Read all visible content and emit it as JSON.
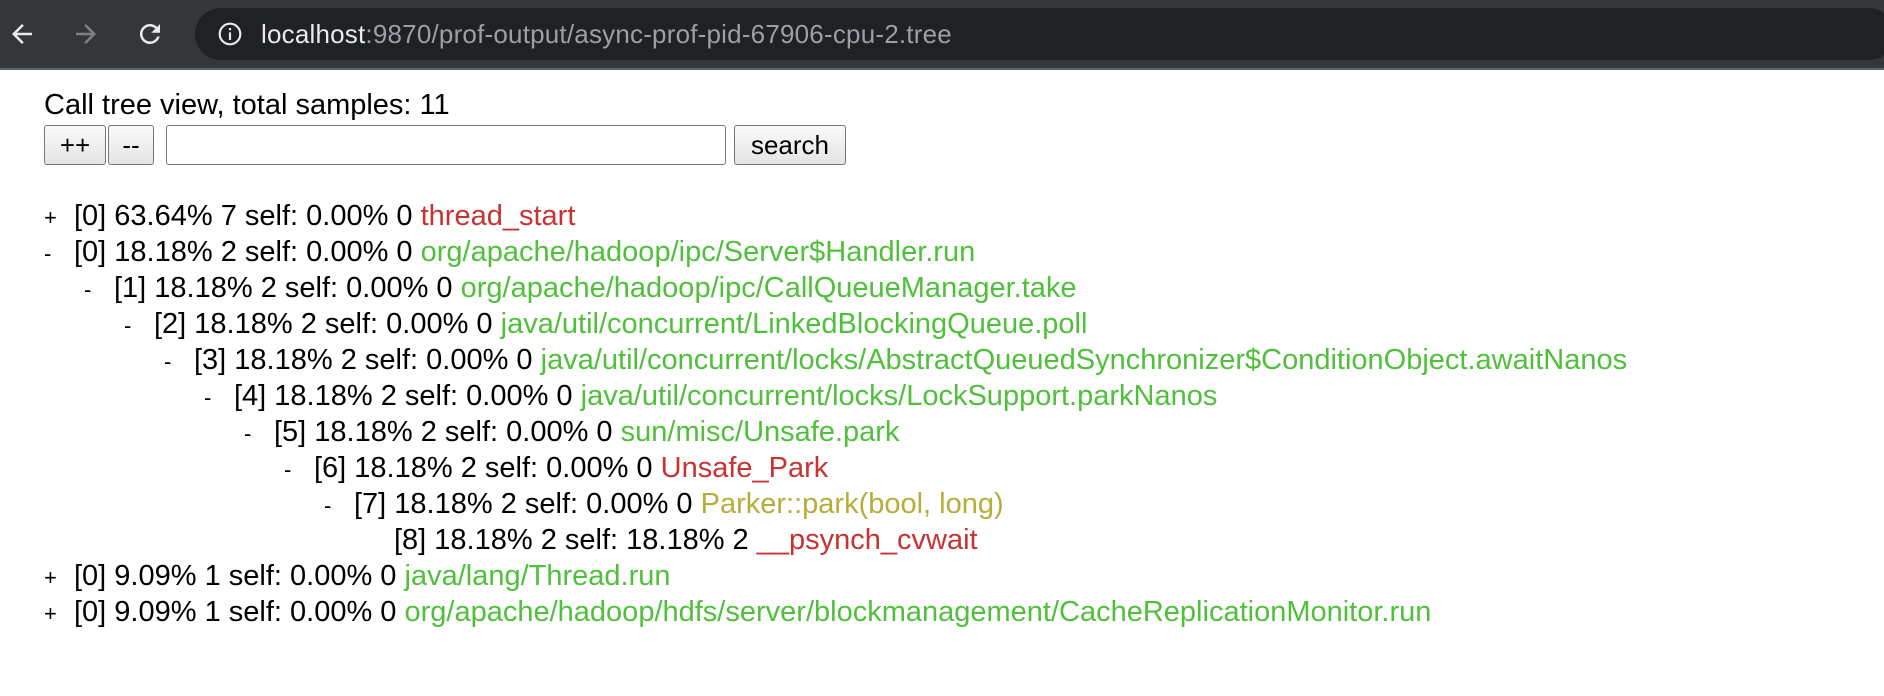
{
  "browser": {
    "url_host": "localhost",
    "url_rest": ":9870/prof-output/async-prof-pid-67906-cpu-2.tree",
    "icons": {
      "back": "arrow-left-icon",
      "forward": "arrow-right-icon",
      "reload": "reload-icon",
      "site_info": "info-icon"
    }
  },
  "page": {
    "title": "Call tree view, total samples: 11",
    "expand_label": "++",
    "collapse_label": "--",
    "search_value": "",
    "search_label": "search"
  },
  "colors": {
    "java_frame": "#50c03c",
    "native_frame": "#c93232",
    "cpp_frame": "#b6ad3a"
  },
  "tree": [
    {
      "toggle": "+",
      "level": 0,
      "info": "[0] 63.64% 7 self: 0.00% 0",
      "name": "thread_start",
      "kind": "red"
    },
    {
      "toggle": "-",
      "level": 0,
      "info": "[0] 18.18% 2 self: 0.00% 0",
      "name": "org/apache/hadoop/ipc/Server$Handler.run",
      "kind": "green"
    },
    {
      "toggle": "-",
      "level": 1,
      "info": "[1] 18.18% 2 self: 0.00% 0",
      "name": "org/apache/hadoop/ipc/CallQueueManager.take",
      "kind": "green"
    },
    {
      "toggle": "-",
      "level": 2,
      "info": "[2] 18.18% 2 self: 0.00% 0",
      "name": "java/util/concurrent/LinkedBlockingQueue.poll",
      "kind": "green"
    },
    {
      "toggle": "-",
      "level": 3,
      "info": "[3] 18.18% 2 self: 0.00% 0",
      "name": "java/util/concurrent/locks/AbstractQueuedSynchronizer$ConditionObject.awaitNanos",
      "kind": "green"
    },
    {
      "toggle": "-",
      "level": 4,
      "info": "[4] 18.18% 2 self: 0.00% 0",
      "name": "java/util/concurrent/locks/LockSupport.parkNanos",
      "kind": "green"
    },
    {
      "toggle": "-",
      "level": 5,
      "info": "[5] 18.18% 2 self: 0.00% 0",
      "name": "sun/misc/Unsafe.park",
      "kind": "green"
    },
    {
      "toggle": "-",
      "level": 6,
      "info": "[6] 18.18% 2 self: 0.00% 0",
      "name": "Unsafe_Park",
      "kind": "red"
    },
    {
      "toggle": "-",
      "level": 7,
      "info": "[7] 18.18% 2 self: 0.00% 0",
      "name": "Parker::park(bool, long)",
      "kind": "olive"
    },
    {
      "toggle": "",
      "level": 8,
      "info": "[8] 18.18% 2 self: 18.18% 2",
      "name": "__psynch_cvwait",
      "kind": "red"
    },
    {
      "toggle": "+",
      "level": 0,
      "info": "[0] 9.09% 1 self: 0.00% 0",
      "name": "java/lang/Thread.run",
      "kind": "green"
    },
    {
      "toggle": "+",
      "level": 0,
      "info": "[0] 9.09% 1 self: 0.00% 0",
      "name": "org/apache/hadoop/hdfs/server/blockmanagement/CacheReplicationMonitor.run",
      "kind": "green"
    }
  ]
}
